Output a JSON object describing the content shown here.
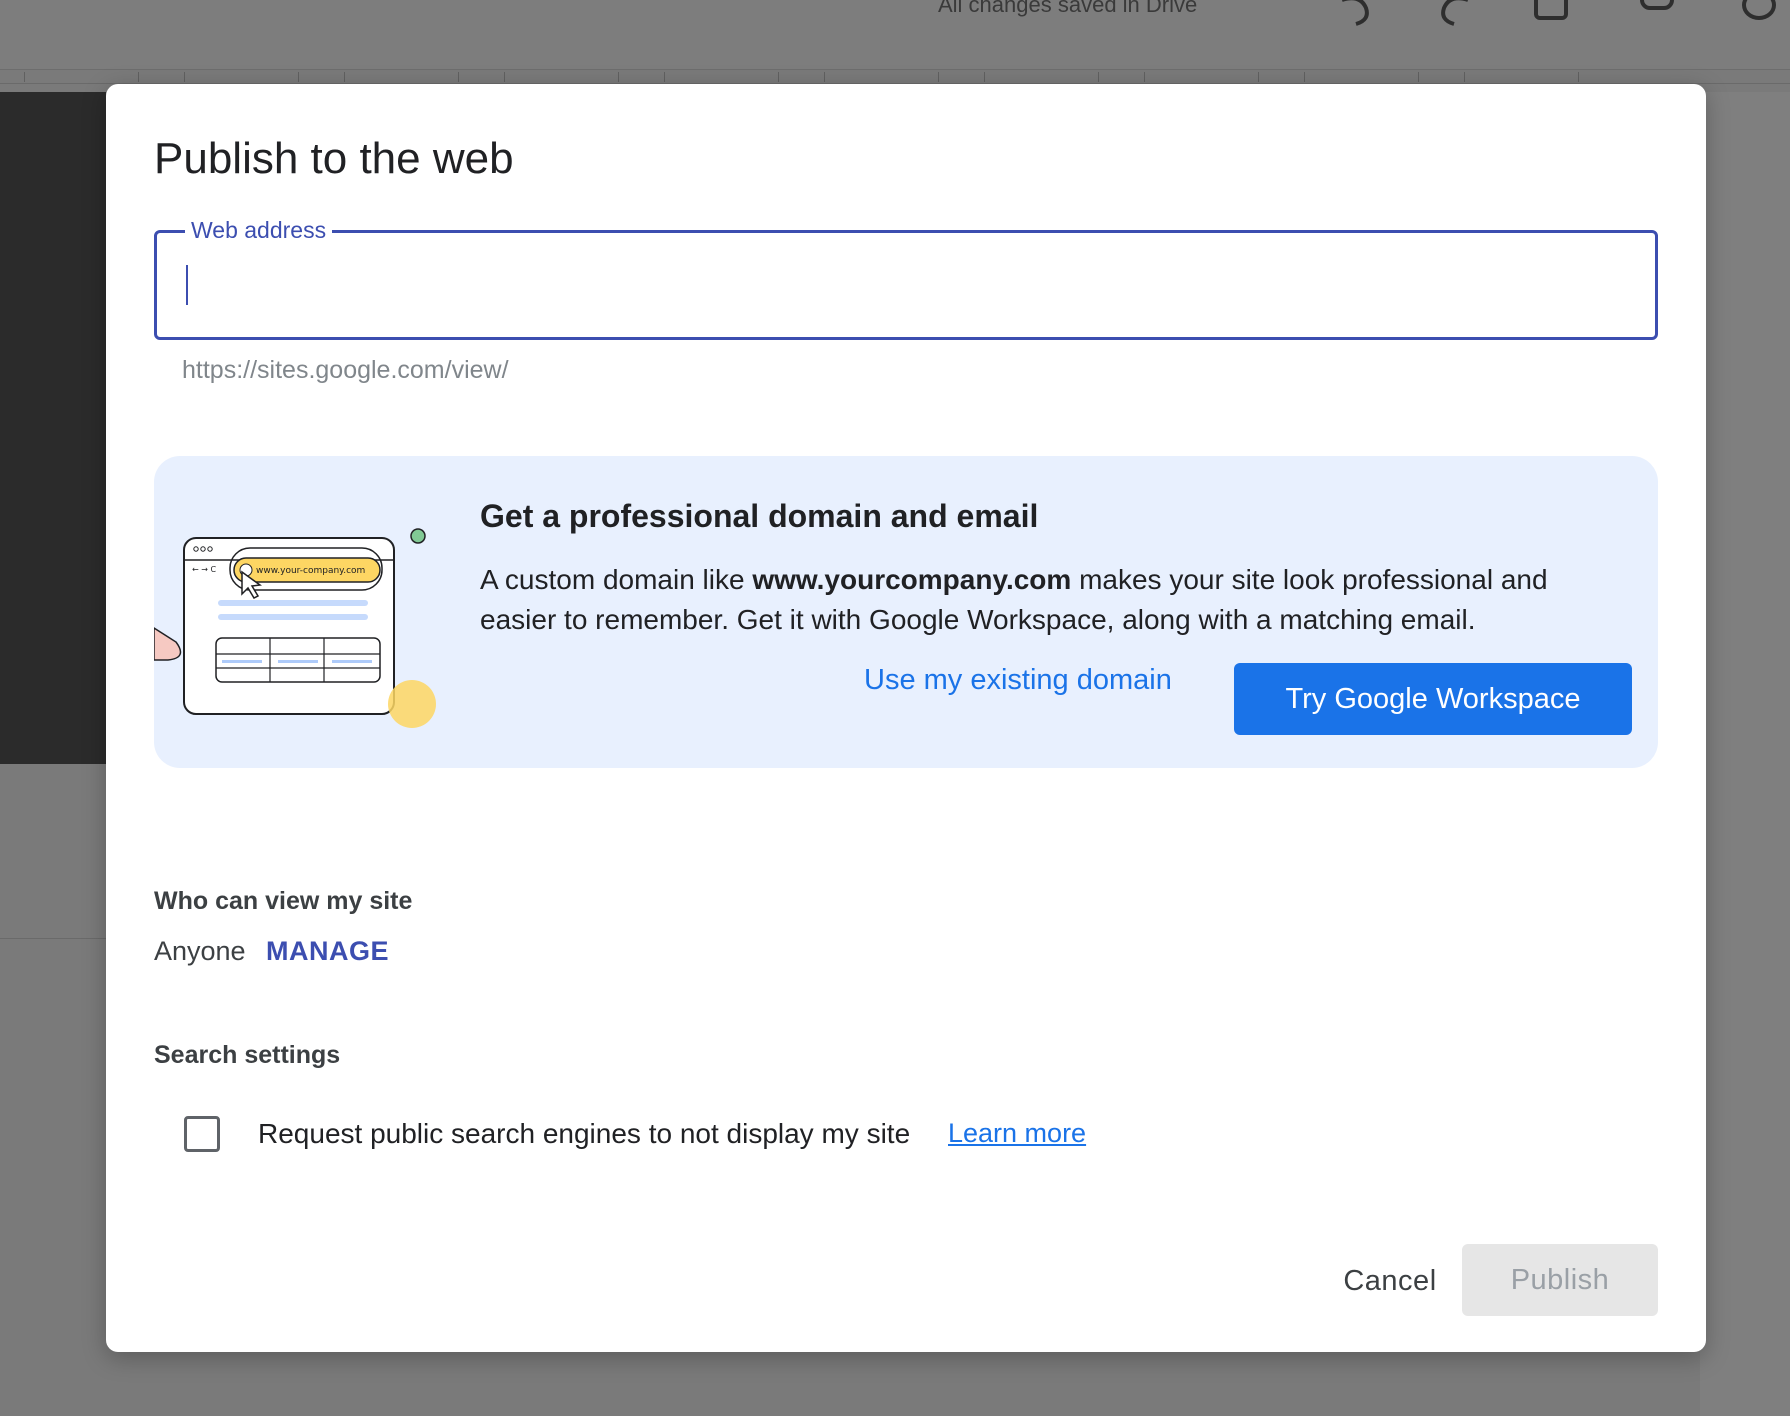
{
  "background": {
    "save_status": "All changes saved in Drive"
  },
  "dialog": {
    "title": "Publish to the web",
    "web_address": {
      "label": "Web address",
      "value": "",
      "hint": "https://sites.google.com/view/"
    },
    "promo": {
      "illustration_url": "www.your-company.com",
      "title": "Get a professional domain and email",
      "text_before": "A custom domain like ",
      "domain_example": "www.yourcompany.com",
      "text_after": " makes your site look professional and easier to remember. Get it with Google Workspace, along with a matching email.",
      "existing_domain_label": "Use my existing domain",
      "try_workspace_label": "Try Google Workspace"
    },
    "who_can_view": {
      "heading": "Who can view my site",
      "value": "Anyone",
      "manage_label": "MANAGE"
    },
    "search_settings": {
      "heading": "Search settings",
      "checkbox_label": "Request public search engines to not display my site",
      "checked": false,
      "learn_more_label": "Learn more"
    },
    "actions": {
      "cancel_label": "Cancel",
      "publish_label": "Publish"
    }
  },
  "colors": {
    "accent": "#1a73e8",
    "field_focus": "#3c4eb0",
    "promo_bg": "#e8f0fe",
    "scrim": "#7a7a7a"
  }
}
